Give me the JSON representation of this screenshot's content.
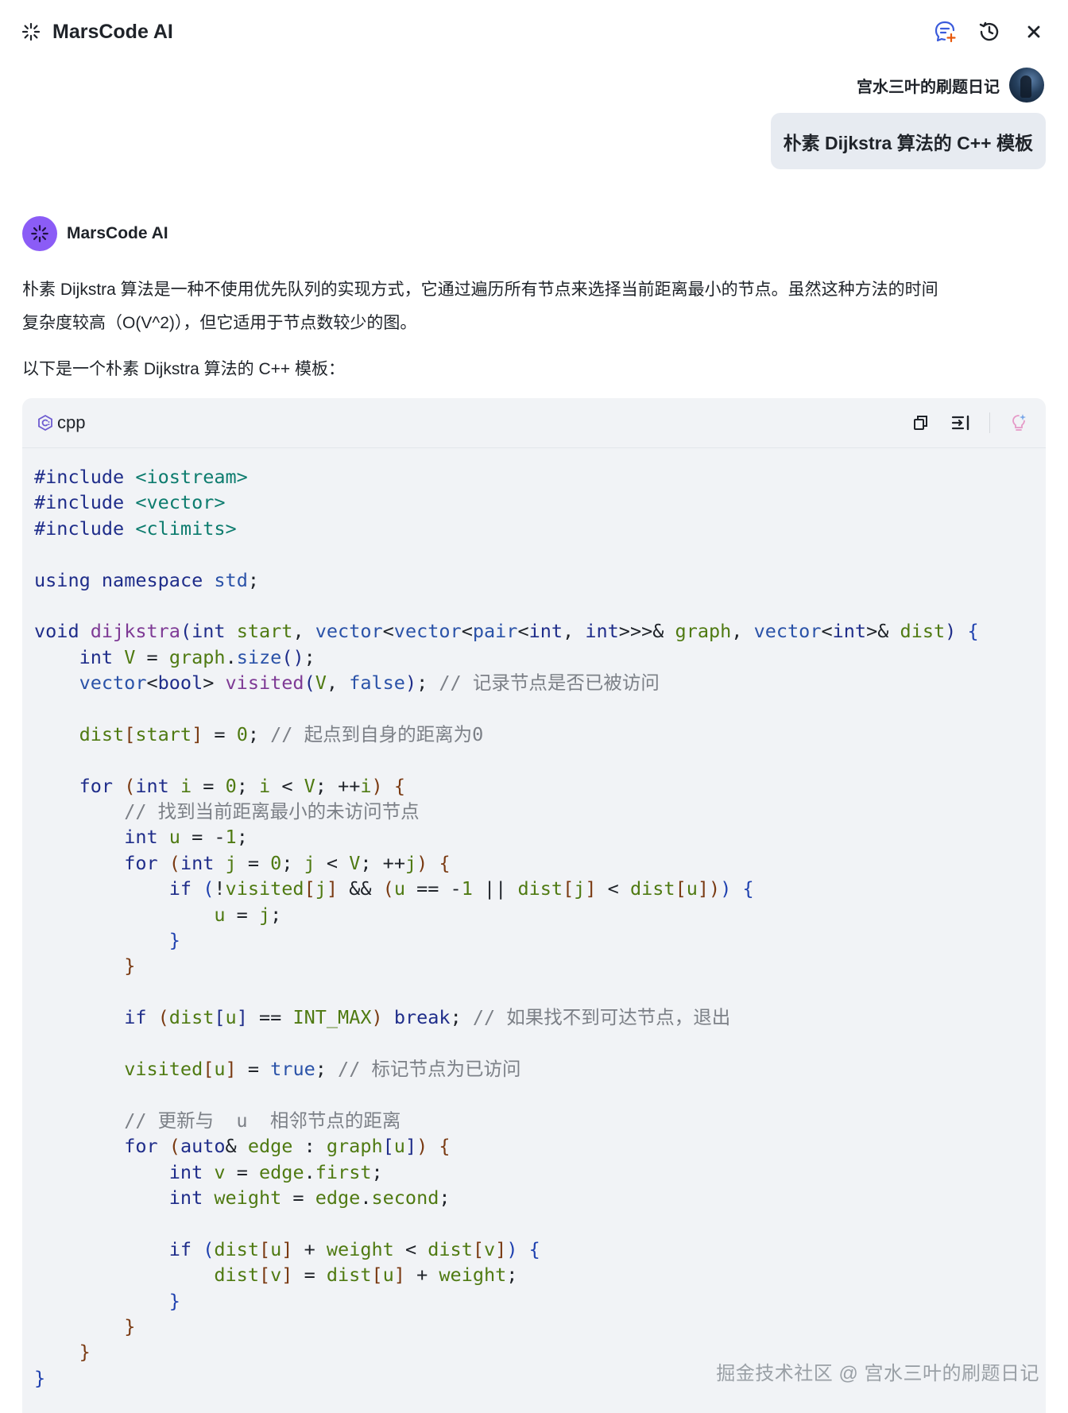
{
  "header": {
    "title": "MarsCode AI",
    "actions": [
      "new-chat-icon",
      "history-icon",
      "close-icon"
    ]
  },
  "user": {
    "name": "宫水三叶的刷题日记",
    "message": "朴素 Dijkstra 算法的 C++ 模板"
  },
  "assistant": {
    "name": "MarsCode AI",
    "intro_line1": "朴素 Dijkstra 算法是一种不使用优先队列的实现方式，它通过遍历所有节点来选择当前距离最小的节点。虽然这种方法的时间",
    "intro_line2": "复杂度较高（O(V^2)），但它适用于节点数较少的图。",
    "intro_line3": "以下是一个朴素 Dijkstra 算法的 C++ 模板："
  },
  "code_block": {
    "language": "cpp",
    "lines": [
      [
        [
          "pp",
          "#include"
        ],
        [
          "",
          "&#32;"
        ],
        [
          "str",
          "<iostream>"
        ]
      ],
      [
        [
          "pp",
          "#include"
        ],
        [
          "",
          "&#32;"
        ],
        [
          "str",
          "<vector>"
        ]
      ],
      [
        [
          "pp",
          "#include"
        ],
        [
          "",
          "&#32;"
        ],
        [
          "str",
          "<climits>"
        ]
      ],
      [],
      [
        [
          "kw",
          "using"
        ],
        [
          "",
          "&#32;"
        ],
        [
          "kw",
          "namespace"
        ],
        [
          "",
          "&#32;"
        ],
        [
          "type",
          "std"
        ],
        [
          "",
          ";"
        ]
      ],
      [],
      [
        [
          "kw",
          "void"
        ],
        [
          "",
          "&#32;"
        ],
        [
          "fn",
          "dijkstra"
        ],
        [
          "br",
          "("
        ],
        [
          "kw",
          "int"
        ],
        [
          "",
          "&#32;"
        ],
        [
          "id",
          "start"
        ],
        [
          "",
          ",&#32;"
        ],
        [
          "type",
          "vector"
        ],
        [
          "",
          "<"
        ],
        [
          "type",
          "vector"
        ],
        [
          "",
          "<"
        ],
        [
          "type",
          "pair"
        ],
        [
          "",
          "<"
        ],
        [
          "kw",
          "int"
        ],
        [
          "",
          ",&#32;"
        ],
        [
          "kw",
          "int"
        ],
        [
          "",
          ">>>&&#32;"
        ],
        [
          "id",
          "graph"
        ],
        [
          "",
          ",&#32;"
        ],
        [
          "type",
          "vector"
        ],
        [
          "",
          "<"
        ],
        [
          "kw",
          "int"
        ],
        [
          "",
          ">&&#32;"
        ],
        [
          "id",
          "dist"
        ],
        [
          "br",
          ")"
        ],
        [
          "",
          "&#32;"
        ],
        [
          "brace",
          "{"
        ]
      ],
      [
        [
          "",
          "&#32;&#32;&#32;&#32;"
        ],
        [
          "kw",
          "int"
        ],
        [
          "",
          "&#32;"
        ],
        [
          "id",
          "V"
        ],
        [
          "",
          "&#32;=&#32;"
        ],
        [
          "id",
          "graph"
        ],
        [
          "",
          "."
        ],
        [
          "type",
          "size"
        ],
        [
          "br",
          "()"
        ],
        [
          "",
          ";"
        ]
      ],
      [
        [
          "",
          "&#32;&#32;&#32;&#32;"
        ],
        [
          "type",
          "vector"
        ],
        [
          "",
          "<"
        ],
        [
          "kw",
          "bool"
        ],
        [
          "",
          ">&#32;"
        ],
        [
          "fn",
          "visited"
        ],
        [
          "br",
          "("
        ],
        [
          "id",
          "V"
        ],
        [
          "",
          ",&#32;"
        ],
        [
          "type",
          "false"
        ],
        [
          "br",
          ")"
        ],
        [
          "",
          ";&#32;"
        ],
        [
          "cm",
          "// 记录节点是否已被访问"
        ]
      ],
      [],
      [
        [
          "",
          "&#32;&#32;&#32;&#32;"
        ],
        [
          "id",
          "dist"
        ],
        [
          "brace2",
          "["
        ],
        [
          "id",
          "start"
        ],
        [
          "brace2",
          "]"
        ],
        [
          "",
          "&#32;=&#32;"
        ],
        [
          "num",
          "0"
        ],
        [
          "",
          ";&#32;"
        ],
        [
          "cm",
          "// 起点到自身的距离为0"
        ]
      ],
      [],
      [
        [
          "",
          "&#32;&#32;&#32;&#32;"
        ],
        [
          "kw",
          "for"
        ],
        [
          "",
          "&#32;"
        ],
        [
          "brace2",
          "("
        ],
        [
          "kw",
          "int"
        ],
        [
          "",
          "&#32;"
        ],
        [
          "id",
          "i"
        ],
        [
          "",
          "&#32;=&#32;"
        ],
        [
          "num",
          "0"
        ],
        [
          "",
          ";&#32;"
        ],
        [
          "id",
          "i"
        ],
        [
          "",
          "&#32;<&#32;"
        ],
        [
          "id",
          "V"
        ],
        [
          "",
          ";&#32;++"
        ],
        [
          "id",
          "i"
        ],
        [
          "brace2",
          ")"
        ],
        [
          "",
          "&#32;"
        ],
        [
          "brace2",
          "{"
        ]
      ],
      [
        [
          "",
          "&#32;&#32;&#32;&#32;&#32;&#32;&#32;&#32;"
        ],
        [
          "cm",
          "// 找到当前距离最小的未访问节点"
        ]
      ],
      [
        [
          "",
          "&#32;&#32;&#32;&#32;&#32;&#32;&#32;&#32;"
        ],
        [
          "kw",
          "int"
        ],
        [
          "",
          "&#32;"
        ],
        [
          "id",
          "u"
        ],
        [
          "",
          "&#32;=&#32;-"
        ],
        [
          "num",
          "1"
        ],
        [
          "",
          ";"
        ]
      ],
      [
        [
          "",
          "&#32;&#32;&#32;&#32;&#32;&#32;&#32;&#32;"
        ],
        [
          "kw",
          "for"
        ],
        [
          "",
          "&#32;"
        ],
        [
          "brace2",
          "("
        ],
        [
          "kw",
          "int"
        ],
        [
          "",
          "&#32;"
        ],
        [
          "id",
          "j"
        ],
        [
          "",
          "&#32;=&#32;"
        ],
        [
          "num",
          "0"
        ],
        [
          "",
          ";&#32;"
        ],
        [
          "id",
          "j"
        ],
        [
          "",
          "&#32;<&#32;"
        ],
        [
          "id",
          "V"
        ],
        [
          "",
          ";&#32;++"
        ],
        [
          "id",
          "j"
        ],
        [
          "brace2",
          ")"
        ],
        [
          "",
          "&#32;"
        ],
        [
          "brace2",
          "{"
        ]
      ],
      [
        [
          "",
          "&#32;&#32;&#32;&#32;&#32;&#32;&#32;&#32;&#32;&#32;&#32;&#32;"
        ],
        [
          "kw",
          "if"
        ],
        [
          "",
          "&#32;"
        ],
        [
          "brace",
          "("
        ],
        [
          "",
          "!"
        ],
        [
          "id",
          "visited"
        ],
        [
          "brace2",
          "["
        ],
        [
          "id",
          "j"
        ],
        [
          "brace2",
          "]"
        ],
        [
          "",
          "&#32;&&&#32;"
        ],
        [
          "brace2",
          "("
        ],
        [
          "id",
          "u"
        ],
        [
          "",
          "&#32;==&#32;-"
        ],
        [
          "num",
          "1"
        ],
        [
          "",
          "&#32;||&#32;"
        ],
        [
          "id",
          "dist"
        ],
        [
          "brace2",
          "["
        ],
        [
          "id",
          "j"
        ],
        [
          "brace2",
          "]"
        ],
        [
          "",
          "&#32;<&#32;"
        ],
        [
          "id",
          "dist"
        ],
        [
          "brace2",
          "["
        ],
        [
          "id",
          "u"
        ],
        [
          "brace2",
          "])"
        ],
        [
          "brace",
          ")"
        ],
        [
          "",
          "&#32;"
        ],
        [
          "brace",
          "{"
        ]
      ],
      [
        [
          "",
          "&#32;&#32;&#32;&#32;&#32;&#32;&#32;&#32;&#32;&#32;&#32;&#32;&#32;&#32;&#32;&#32;"
        ],
        [
          "id",
          "u"
        ],
        [
          "",
          "&#32;=&#32;"
        ],
        [
          "id",
          "j"
        ],
        [
          "",
          ";"
        ]
      ],
      [
        [
          "",
          "&#32;&#32;&#32;&#32;&#32;&#32;&#32;&#32;&#32;&#32;&#32;&#32;"
        ],
        [
          "brace",
          "}"
        ]
      ],
      [
        [
          "",
          "&#32;&#32;&#32;&#32;&#32;&#32;&#32;&#32;"
        ],
        [
          "brace2",
          "}"
        ]
      ],
      [],
      [
        [
          "",
          "&#32;&#32;&#32;&#32;&#32;&#32;&#32;&#32;"
        ],
        [
          "kw",
          "if"
        ],
        [
          "",
          "&#32;"
        ],
        [
          "brace2",
          "("
        ],
        [
          "id",
          "dist"
        ],
        [
          "br",
          "["
        ],
        [
          "id",
          "u"
        ],
        [
          "br",
          "]"
        ],
        [
          "",
          "&#32;==&#32;"
        ],
        [
          "const",
          "INT_MAX"
        ],
        [
          "brace2",
          ")"
        ],
        [
          "",
          "&#32;"
        ],
        [
          "kw",
          "break"
        ],
        [
          "",
          ";&#32;"
        ],
        [
          "cm",
          "// 如果找不到可达节点，退出"
        ]
      ],
      [],
      [
        [
          "",
          "&#32;&#32;&#32;&#32;&#32;&#32;&#32;&#32;"
        ],
        [
          "id",
          "visited"
        ],
        [
          "brace2",
          "["
        ],
        [
          "id",
          "u"
        ],
        [
          "brace2",
          "]"
        ],
        [
          "",
          "&#32;=&#32;"
        ],
        [
          "type",
          "true"
        ],
        [
          "",
          ";&#32;"
        ],
        [
          "cm",
          "// 标记节点为已访问"
        ]
      ],
      [],
      [
        [
          "",
          "&#32;&#32;&#32;&#32;&#32;&#32;&#32;&#32;"
        ],
        [
          "cm",
          "// 更新与&#32;&#32;u&#32;&#32;相邻节点的距离"
        ]
      ],
      [
        [
          "",
          "&#32;&#32;&#32;&#32;&#32;&#32;&#32;&#32;"
        ],
        [
          "kw",
          "for"
        ],
        [
          "",
          "&#32;"
        ],
        [
          "brace2",
          "("
        ],
        [
          "kw",
          "auto"
        ],
        [
          "",
          "&&#32;"
        ],
        [
          "id",
          "edge"
        ],
        [
          "",
          "&#32;:&#32;"
        ],
        [
          "id",
          "graph"
        ],
        [
          "br",
          "["
        ],
        [
          "id",
          "u"
        ],
        [
          "br",
          "]"
        ],
        [
          "brace2",
          ")"
        ],
        [
          "",
          "&#32;"
        ],
        [
          "brace2",
          "{"
        ]
      ],
      [
        [
          "",
          "&#32;&#32;&#32;&#32;&#32;&#32;&#32;&#32;&#32;&#32;&#32;&#32;"
        ],
        [
          "kw",
          "int"
        ],
        [
          "",
          "&#32;"
        ],
        [
          "id",
          "v"
        ],
        [
          "",
          "&#32;=&#32;"
        ],
        [
          "id",
          "edge"
        ],
        [
          "",
          "."
        ],
        [
          "id",
          "first"
        ],
        [
          "",
          ";"
        ]
      ],
      [
        [
          "",
          "&#32;&#32;&#32;&#32;&#32;&#32;&#32;&#32;&#32;&#32;&#32;&#32;"
        ],
        [
          "kw",
          "int"
        ],
        [
          "",
          "&#32;"
        ],
        [
          "id",
          "weight"
        ],
        [
          "",
          "&#32;=&#32;"
        ],
        [
          "id",
          "edge"
        ],
        [
          "",
          "."
        ],
        [
          "id",
          "second"
        ],
        [
          "",
          ";"
        ]
      ],
      [],
      [
        [
          "",
          "&#32;&#32;&#32;&#32;&#32;&#32;&#32;&#32;&#32;&#32;&#32;&#32;"
        ],
        [
          "kw",
          "if"
        ],
        [
          "",
          "&#32;"
        ],
        [
          "brace",
          "("
        ],
        [
          "id",
          "dist"
        ],
        [
          "brace2",
          "["
        ],
        [
          "id",
          "u"
        ],
        [
          "brace2",
          "]"
        ],
        [
          "",
          "&#32;+&#32;"
        ],
        [
          "id",
          "weight"
        ],
        [
          "",
          "&#32;<&#32;"
        ],
        [
          "id",
          "dist"
        ],
        [
          "brace2",
          "["
        ],
        [
          "id",
          "v"
        ],
        [
          "brace2",
          "]"
        ],
        [
          "brace",
          ")"
        ],
        [
          "",
          "&#32;"
        ],
        [
          "brace",
          "{"
        ]
      ],
      [
        [
          "",
          "&#32;&#32;&#32;&#32;&#32;&#32;&#32;&#32;&#32;&#32;&#32;&#32;&#32;&#32;&#32;&#32;"
        ],
        [
          "id",
          "dist"
        ],
        [
          "brace2",
          "["
        ],
        [
          "id",
          "v"
        ],
        [
          "brace2",
          "]"
        ],
        [
          "",
          "&#32;=&#32;"
        ],
        [
          "id",
          "dist"
        ],
        [
          "brace2",
          "["
        ],
        [
          "id",
          "u"
        ],
        [
          "brace2",
          "]"
        ],
        [
          "",
          "&#32;+&#32;"
        ],
        [
          "id",
          "weight"
        ],
        [
          "",
          ";"
        ]
      ],
      [
        [
          "",
          "&#32;&#32;&#32;&#32;&#32;&#32;&#32;&#32;&#32;&#32;&#32;&#32;"
        ],
        [
          "brace",
          "}"
        ]
      ],
      [
        [
          "",
          "&#32;&#32;&#32;&#32;&#32;&#32;&#32;&#32;"
        ],
        [
          "brace2",
          "}"
        ]
      ],
      [
        [
          "",
          "&#32;&#32;&#32;&#32;"
        ],
        [
          "brace2",
          "}"
        ]
      ],
      [
        [
          "brace",
          "}"
        ]
      ]
    ]
  },
  "watermark": "掘金技术社区 @ 宫水三叶的刷题日记",
  "colors": {
    "accent": "#8b5cf6",
    "bubble": "#e7ebf1",
    "code_bg": "#f1f3f6"
  }
}
